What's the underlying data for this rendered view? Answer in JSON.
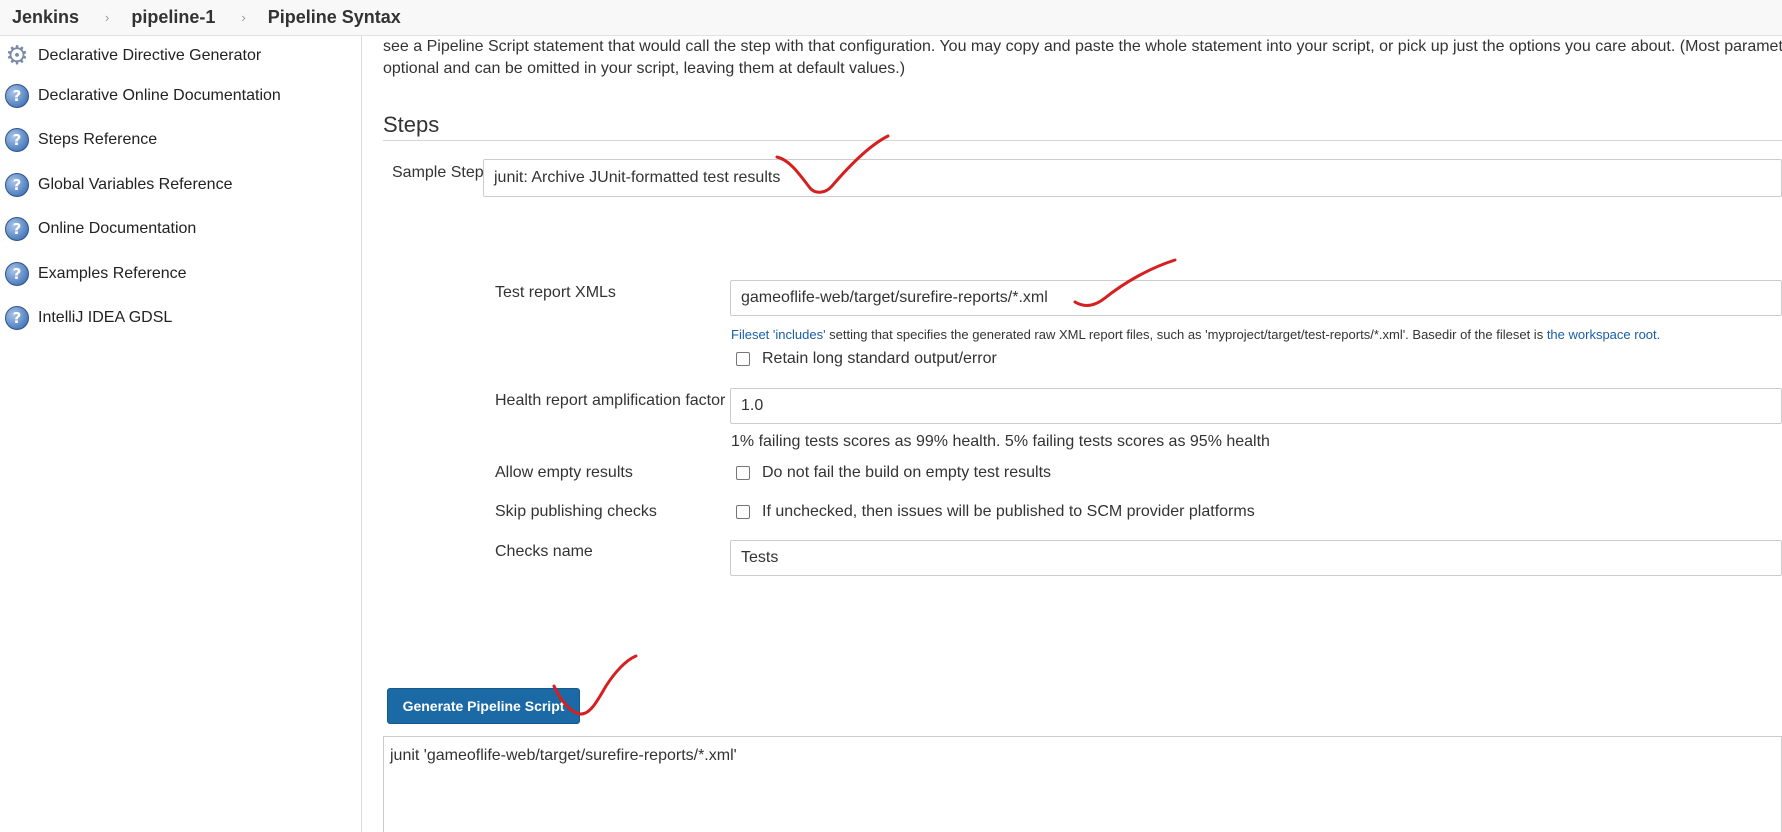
{
  "breadcrumb": {
    "items": [
      "Jenkins",
      "pipeline-1",
      "Pipeline Syntax"
    ],
    "separator": "›"
  },
  "sidebar": {
    "items": [
      {
        "label": "Declarative Directive Generator",
        "icon": "gear-icon"
      },
      {
        "label": "Declarative Online Documentation",
        "icon": "help-icon"
      },
      {
        "label": "Steps Reference",
        "icon": "help-icon"
      },
      {
        "label": "Global Variables Reference",
        "icon": "help-icon"
      },
      {
        "label": "Online Documentation",
        "icon": "help-icon"
      },
      {
        "label": "Examples Reference",
        "icon": "help-icon"
      },
      {
        "label": "IntelliJ IDEA GDSL",
        "icon": "help-icon"
      }
    ],
    "help_glyph": "?",
    "gear_glyph": "⚙"
  },
  "main": {
    "intro_line1": "see a Pipeline Script statement that would call the step with that configuration. You may copy and paste the whole statement into your script, or pick up just the options you care about. (Most parameters are",
    "intro_line2": "optional and can be omitted in your script, leaving them at default values.)",
    "section_title": "Steps",
    "sample_step": {
      "label": "Sample Step",
      "value": "junit: Archive JUnit-formatted test results"
    },
    "test_report": {
      "label": "Test report XMLs",
      "value": "gameoflife-web/target/surefire-reports/*.xml",
      "help_prefix": "Fileset 'includes'",
      "help_middle": " setting that specifies the generated raw XML report files, such as 'myproject/target/test-reports/*.xml'. Basedir of the fileset is ",
      "help_link": "the workspace root."
    },
    "retain_output": {
      "label": "Retain long standard output/error",
      "checked": false
    },
    "health_factor": {
      "label": "Health report amplification factor",
      "value": "1.0",
      "note": "1% failing tests scores as 99% health. 5% failing tests scores as 95% health"
    },
    "allow_empty": {
      "label": "Allow empty results",
      "checkbox_label": "Do not fail the build on empty test results",
      "checked": false
    },
    "skip_checks": {
      "label": "Skip publishing checks",
      "checkbox_label": "If unchecked, then issues will be published to SCM provider platforms",
      "checked": false
    },
    "checks_name": {
      "label": "Checks name",
      "value": "Tests"
    },
    "generate_button": "Generate Pipeline Script",
    "script_output": "junit 'gameoflife-web/target/surefire-reports/*.xml'"
  },
  "colors": {
    "button_bg": "#1b6aa5",
    "link": "#1a5ea8",
    "annotation_mark": "#d61f1f"
  }
}
